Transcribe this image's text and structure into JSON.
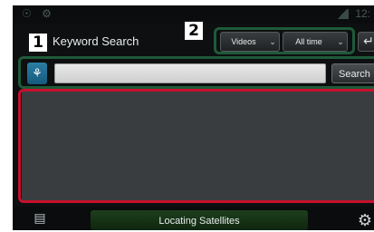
{
  "statusbar": {
    "left_icons": "☉ ⚙",
    "time": "12:"
  },
  "header": {
    "title": "Keyword Search",
    "back_glyph": "↵"
  },
  "filters": {
    "type_value": "Videos",
    "time_value": "All time",
    "chevron": "⌄"
  },
  "search": {
    "mic_glyph": "⚘",
    "input_value": "",
    "input_placeholder": "",
    "button_label": "Search"
  },
  "footer": {
    "map_glyph": "▤",
    "status_text": "Locating Satellites",
    "gear_glyph": "⚙"
  },
  "callouts": [
    {
      "label": "1",
      "color": "#1f5a3a"
    },
    {
      "label": "2",
      "color": "#1f5a3a"
    },
    {
      "color": "#c8102e"
    }
  ],
  "colors": {
    "screen_bg": "#0d0f10",
    "results_bg": "#3a3d3f",
    "mic_accent": "#2b7ea4",
    "status_green": "#1d3f1d",
    "callout_green": "#1f5a3a",
    "callout_red": "#c8102e"
  }
}
